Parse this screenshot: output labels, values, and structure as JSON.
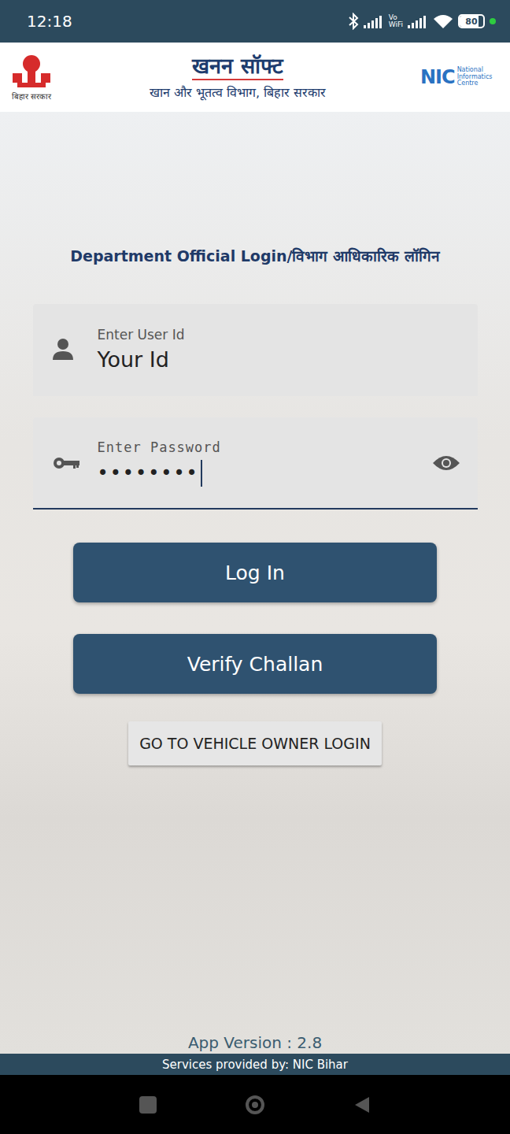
{
  "status_bar": {
    "time": "12:18",
    "vowifi": [
      "Vo",
      "WiFi"
    ],
    "battery": "80",
    "battery_level": 0.8
  },
  "header": {
    "emblem_caption": "बिहार सरकार",
    "title": "खनन सॉफ्ट",
    "subtitle": "खान और भूतत्व विभाग, बिहार सरकार",
    "nic": "NIC",
    "nic_caption": [
      "National",
      "Informatics",
      "Centre"
    ]
  },
  "form": {
    "title": "Department Official Login/विभाग आधिकारिक लॉगिन",
    "fields": [
      {
        "kind": "text",
        "label": "Enter User Id",
        "value": "Your Id",
        "focused": false
      },
      {
        "kind": "password",
        "label": "Enter Password",
        "value": "••••••••",
        "focused": true
      }
    ]
  },
  "buttons": [
    {
      "kind": "primary",
      "label": "Log In"
    },
    {
      "kind": "primary",
      "label": "Verify Challan"
    },
    {
      "kind": "secondary",
      "label": "GO TO VEHICLE OWNER LOGIN"
    }
  ],
  "version": "App Version : 2.8",
  "footer": "Services provided by: NIC Bihar"
}
